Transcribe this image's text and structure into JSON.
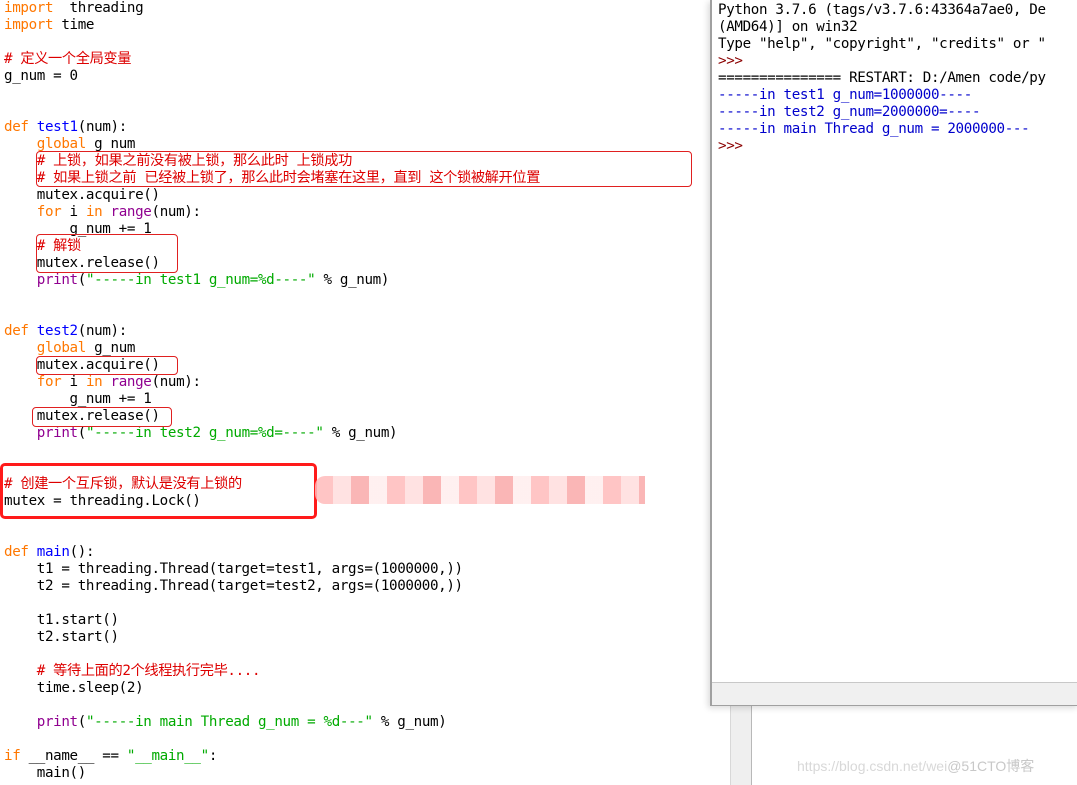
{
  "editor": {
    "lines": [
      {
        "i": 0,
        "parts": [
          [
            "kw",
            "import"
          ],
          [
            "",
            "  threading"
          ]
        ]
      },
      {
        "i": 1,
        "parts": [
          [
            "kw",
            "import"
          ],
          [
            "",
            " time"
          ]
        ]
      },
      {
        "i": 3,
        "parts": [
          [
            "cm",
            "# 定义一个全局变量"
          ]
        ]
      },
      {
        "i": 4,
        "parts": [
          [
            "",
            "g_num = 0"
          ]
        ]
      },
      {
        "i": 7,
        "parts": [
          [
            "kw",
            "def"
          ],
          [
            "",
            " "
          ],
          [
            "fn",
            "test1"
          ],
          [
            "",
            "(num):"
          ]
        ]
      },
      {
        "i": 8,
        "parts": [
          [
            "",
            "    "
          ],
          [
            "kw",
            "global"
          ],
          [
            "",
            " g_num"
          ]
        ]
      },
      {
        "i": 9,
        "parts": [
          [
            "",
            "    "
          ],
          [
            "cm",
            "# 上锁，如果之前没有被上锁，那么此时 上锁成功"
          ]
        ]
      },
      {
        "i": 10,
        "parts": [
          [
            "",
            "    "
          ],
          [
            "cm",
            "# 如果上锁之前 已经被上锁了，那么此时会堵塞在这里，直到 这个锁被解开位置"
          ]
        ]
      },
      {
        "i": 11,
        "parts": [
          [
            "",
            "    mutex.acquire()"
          ]
        ]
      },
      {
        "i": 12,
        "parts": [
          [
            "",
            "    "
          ],
          [
            "kw",
            "for"
          ],
          [
            "",
            " i "
          ],
          [
            "kw",
            "in"
          ],
          [
            "",
            " "
          ],
          [
            "bi",
            "range"
          ],
          [
            "",
            "(num):"
          ]
        ]
      },
      {
        "i": 13,
        "parts": [
          [
            "",
            "        g_num += 1"
          ]
        ]
      },
      {
        "i": 14,
        "parts": [
          [
            "",
            "    "
          ],
          [
            "cm",
            "# 解锁"
          ]
        ]
      },
      {
        "i": 15,
        "parts": [
          [
            "",
            "    mutex.release()"
          ]
        ]
      },
      {
        "i": 16,
        "parts": [
          [
            "",
            "    "
          ],
          [
            "bi",
            "print"
          ],
          [
            "",
            "("
          ],
          [
            "str",
            "\"-----in test1 g_num=%d----\""
          ],
          [
            "",
            " % g_num)"
          ]
        ]
      },
      {
        "i": 19,
        "parts": [
          [
            "kw",
            "def"
          ],
          [
            "",
            " "
          ],
          [
            "fn",
            "test2"
          ],
          [
            "",
            "(num):"
          ]
        ]
      },
      {
        "i": 20,
        "parts": [
          [
            "",
            "    "
          ],
          [
            "kw",
            "global"
          ],
          [
            "",
            " g_num"
          ]
        ]
      },
      {
        "i": 21,
        "parts": [
          [
            "",
            "    mutex.acquire()"
          ]
        ]
      },
      {
        "i": 22,
        "parts": [
          [
            "",
            "    "
          ],
          [
            "kw",
            "for"
          ],
          [
            "",
            " i "
          ],
          [
            "kw",
            "in"
          ],
          [
            "",
            " "
          ],
          [
            "bi",
            "range"
          ],
          [
            "",
            "(num):"
          ]
        ]
      },
      {
        "i": 23,
        "parts": [
          [
            "",
            "        g_num += 1"
          ]
        ]
      },
      {
        "i": 24,
        "parts": [
          [
            "",
            "    mutex.release()"
          ]
        ]
      },
      {
        "i": 25,
        "parts": [
          [
            "",
            "    "
          ],
          [
            "bi",
            "print"
          ],
          [
            "",
            "("
          ],
          [
            "str",
            "\"-----in test2 g_num=%d=----\""
          ],
          [
            "",
            " % g_num)"
          ]
        ]
      },
      {
        "i": 28,
        "parts": [
          [
            "cm",
            "# 创建一个互斥锁，默认是没有上锁的"
          ]
        ]
      },
      {
        "i": 29,
        "parts": [
          [
            "",
            "mutex = threading.Lock()"
          ]
        ]
      },
      {
        "i": 32,
        "parts": [
          [
            "kw",
            "def"
          ],
          [
            "",
            " "
          ],
          [
            "fn",
            "main"
          ],
          [
            "",
            "():"
          ]
        ]
      },
      {
        "i": 33,
        "parts": [
          [
            "",
            "    t1 = threading.Thread(target=test1, args=(1000000,))"
          ]
        ]
      },
      {
        "i": 34,
        "parts": [
          [
            "",
            "    t2 = threading.Thread(target=test2, args=(1000000,))"
          ]
        ]
      },
      {
        "i": 36,
        "parts": [
          [
            "",
            "    t1.start()"
          ]
        ]
      },
      {
        "i": 37,
        "parts": [
          [
            "",
            "    t2.start()"
          ]
        ]
      },
      {
        "i": 39,
        "parts": [
          [
            "",
            "    "
          ],
          [
            "cm",
            "# 等待上面的2个线程执行完毕...."
          ]
        ]
      },
      {
        "i": 40,
        "parts": [
          [
            "",
            "    time.sleep(2)"
          ]
        ]
      },
      {
        "i": 42,
        "parts": [
          [
            "",
            "    "
          ],
          [
            "bi",
            "print"
          ],
          [
            "",
            "("
          ],
          [
            "str",
            "\"-----in main Thread g_num = %d---\""
          ],
          [
            "",
            " % g_num)"
          ]
        ]
      },
      {
        "i": 44,
        "parts": [
          [
            "kw",
            "if"
          ],
          [
            "",
            " __name__ == "
          ],
          [
            "str",
            "\"__main__\""
          ],
          [
            "",
            ":"
          ]
        ]
      },
      {
        "i": 45,
        "parts": [
          [
            "",
            "    main()"
          ]
        ]
      }
    ]
  },
  "shell": {
    "lines": [
      {
        "cls": "",
        "text": "Python 3.7.6 (tags/v3.7.6:43364a7ae0, De"
      },
      {
        "cls": "",
        "text": "(AMD64)] on win32"
      },
      {
        "cls": "",
        "text": "Type \"help\", \"copyright\", \"credits\" or \""
      },
      {
        "cls": "prompt",
        "text": ">>>"
      },
      {
        "cls": "",
        "text": "=============== RESTART: D:/Amen code/py"
      },
      {
        "cls": "out",
        "text": "-----in test1 g_num=1000000----"
      },
      {
        "cls": "out",
        "text": "-----in test2 g_num=2000000=----"
      },
      {
        "cls": "out",
        "text": "-----in main Thread g_num = 2000000---"
      },
      {
        "cls": "prompt",
        "text": ">>>"
      }
    ]
  },
  "watermark": {
    "url": "https://blog.csdn.net/wei",
    "brand": "@51CTO博客"
  },
  "colors": {
    "keyword": "#ff7700",
    "function_name": "#0000ff",
    "builtin": "#900090",
    "string": "#00aa00",
    "comment": "#dd0000",
    "shell_output": "#0000cc",
    "highlight_box": "#ff1a1a"
  }
}
